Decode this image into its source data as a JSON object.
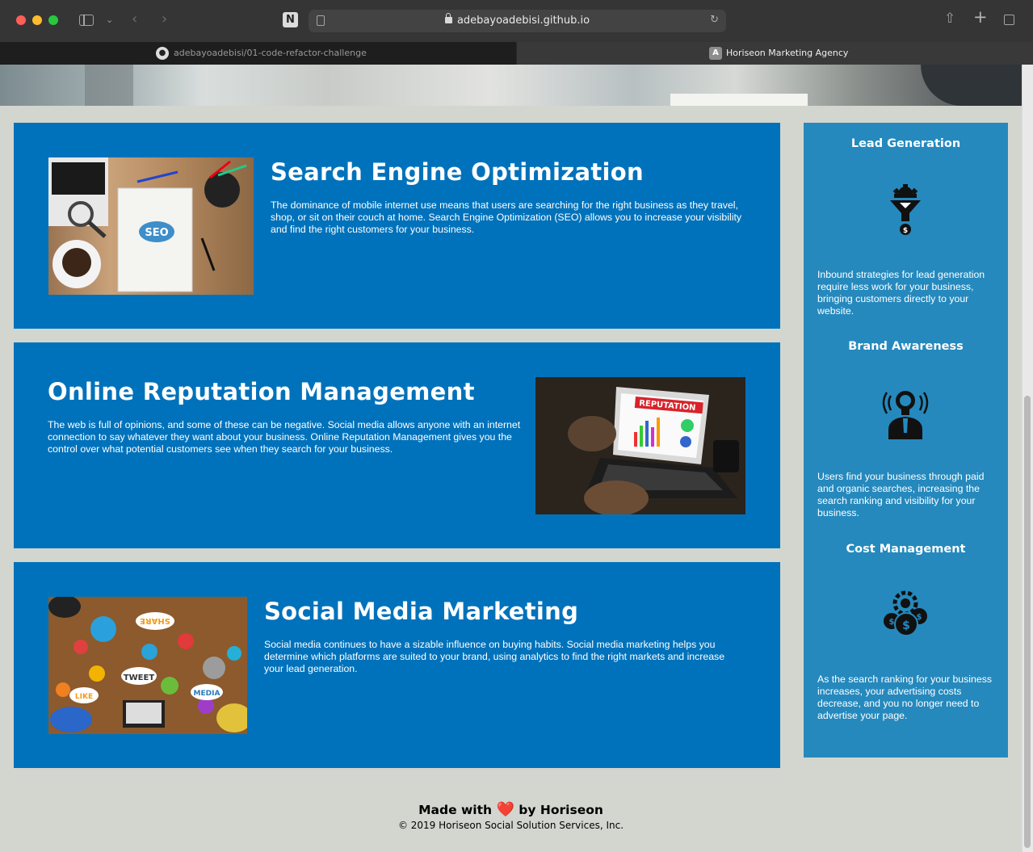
{
  "browser": {
    "url": "adebayoadebisi.github.io",
    "tabs": [
      {
        "label": "adebayoadebisi/01-code-refactor-challenge",
        "favicon": "github-icon",
        "active": false
      },
      {
        "label": "Horiseon Marketing Agency",
        "favicon": "A",
        "active": true
      }
    ],
    "notion_letter": "N"
  },
  "content": [
    {
      "id": "search-engine-optimization",
      "title": "Search Engine Optimization",
      "body": "The dominance of mobile internet use means that users are searching for the right business as they travel, shop, or sit on their couch at home. Search Engine Optimization (SEO) allows you to increase your visibility and find the right customers for your business.",
      "image_label": "SEO"
    },
    {
      "id": "online-reputation-management",
      "title": "Online Reputation Management",
      "body": "The web is full of opinions, and some of these can be negative. Social media allows anyone with an internet connection to say whatever they want about your business. Online Reputation Management gives you the control over what potential customers see when they search for your business.",
      "image_label": "REPUTATION"
    },
    {
      "id": "social-media-marketing",
      "title": "Social Media Marketing",
      "body": "Social media continues to have a sizable influence on buying habits. Social media marketing helps you determine which platforms are suited to your brand, using analytics to find the right markets and increase your lead generation.",
      "image_labels": [
        "SHARE",
        "TWEET",
        "LIKE",
        "MEDIA"
      ]
    }
  ],
  "benefits": [
    {
      "title": "Lead Generation",
      "icon": "lead-funnel-icon",
      "body": "Inbound strategies for lead generation require less work for your business, bringing customers directly to your website."
    },
    {
      "title": "Brand Awareness",
      "icon": "brand-awareness-icon",
      "body": "Users find your business through paid and organic searches, increasing the search ranking and visibility for your business."
    },
    {
      "title": "Cost Management",
      "icon": "cost-management-icon",
      "body": "As the search ranking for your business increases, your advertising costs decrease, and you no longer need to advertise your page."
    }
  ],
  "footer": {
    "made_with": "Made with",
    "heart": "❤️",
    "by": "by Horiseon",
    "copyright": "© 2019 Horiseon Social Solution Services, Inc."
  },
  "colors": {
    "content_bg": "#0072bb",
    "aside_bg": "#2589bd",
    "page_bg": "#d2d6cf"
  }
}
